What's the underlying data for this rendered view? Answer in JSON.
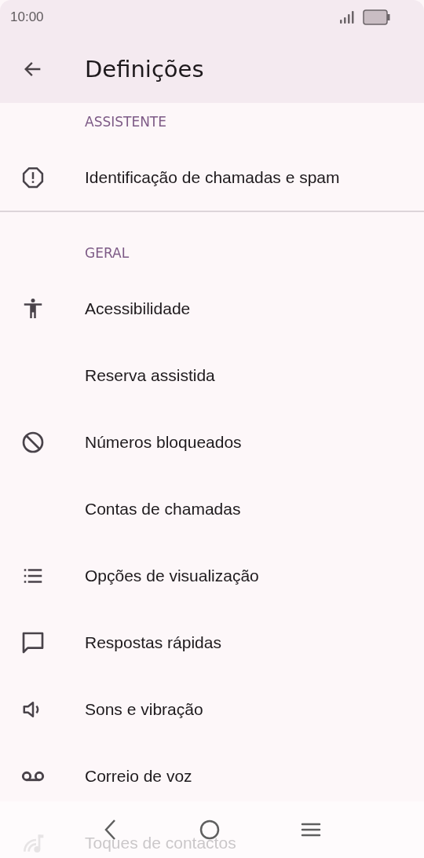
{
  "status_bar": {
    "time": "10:00"
  },
  "app_bar": {
    "title": "Definições"
  },
  "sections": [
    {
      "header": "ASSISTENTE",
      "items": [
        {
          "label": "Identificação de chamadas e spam"
        }
      ]
    },
    {
      "header": "GERAL",
      "items": [
        {
          "label": "Acessibilidade"
        },
        {
          "label": "Reserva assistida"
        },
        {
          "label": "Números bloqueados"
        },
        {
          "label": "Contas de chamadas"
        },
        {
          "label": "Opções de visualização"
        },
        {
          "label": "Respostas rápidas"
        },
        {
          "label": "Sons e vibração"
        },
        {
          "label": "Correio de voz"
        },
        {
          "label": "Toques de contactos"
        }
      ]
    }
  ]
}
